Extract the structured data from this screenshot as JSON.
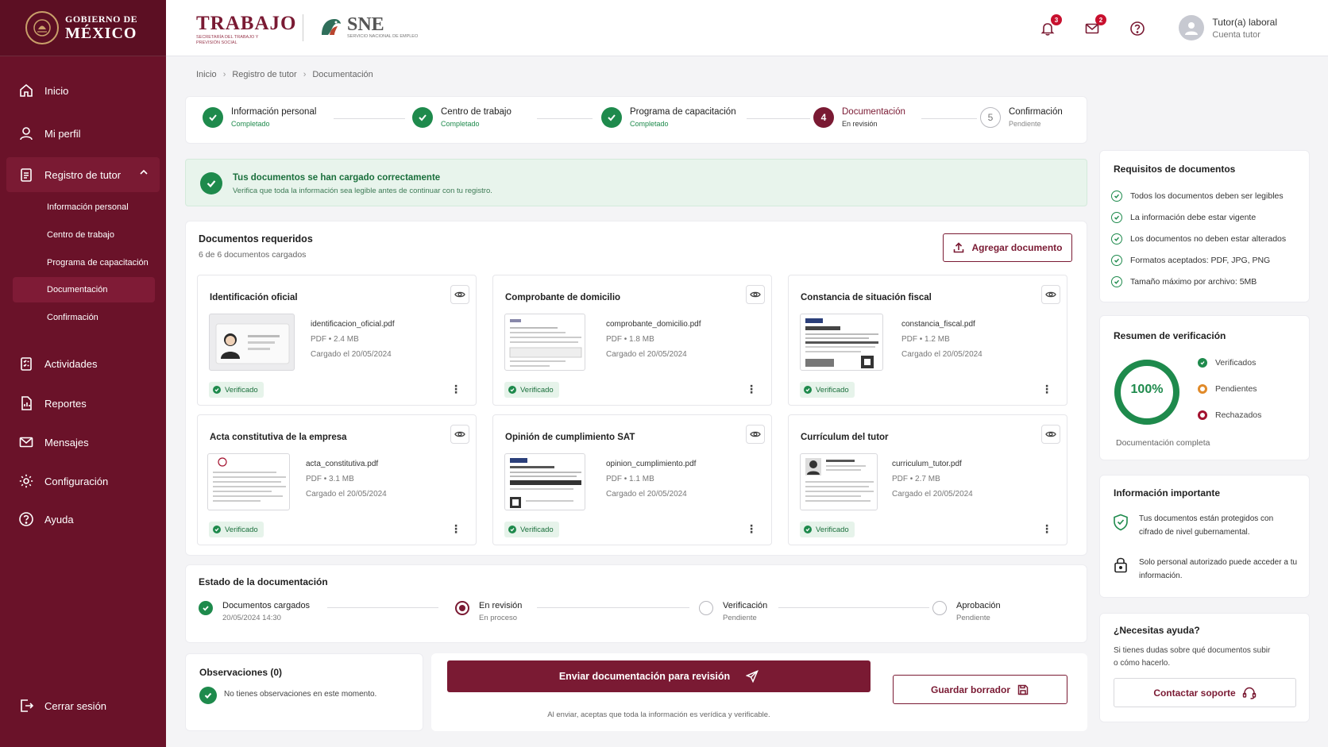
{
  "brand": {
    "line1": "GOBIERNO DE",
    "line2": "MÉXICO"
  },
  "header": {
    "trabajo_title": "TRABAJO",
    "trabajo_sub": "SECRETARÍA DEL TRABAJO Y PREVISIÓN SOCIAL",
    "sne_title": "SNE",
    "sne_sub": "SERVICIO NACIONAL DE EMPLEO",
    "notifications_count": "3",
    "messages_count": "2",
    "user_name": "Tutor(a) laboral",
    "user_role": "Cuenta tutor"
  },
  "sidebar": {
    "inicio": "Inicio",
    "perfil": "Mi perfil",
    "registro": "Registro de tutor",
    "sub": [
      "Información personal",
      "Centro de trabajo",
      "Programa de capacitación",
      "Documentación",
      "Confirmación"
    ],
    "actividades": "Actividades",
    "reportes": "Reportes",
    "mensajes": "Mensajes",
    "configuracion": "Configuración",
    "ayuda": "Ayuda",
    "logout": "Cerrar sesión"
  },
  "breadcrumb": [
    "Inicio",
    "Registro de tutor",
    "Documentación"
  ],
  "stepper": [
    {
      "label": "Información personal",
      "status": "Completado",
      "state": "done"
    },
    {
      "label": "Centro de trabajo",
      "status": "Completado",
      "state": "done"
    },
    {
      "label": "Programa de capacitación",
      "status": "Completado",
      "state": "done"
    },
    {
      "num": "4",
      "label": "Documentación",
      "status": "En revisión",
      "state": "current"
    },
    {
      "num": "5",
      "label": "Confirmación",
      "status": "Pendiente",
      "state": "pending"
    }
  ],
  "alert": {
    "title": "Tus documentos se han cargado correctamente",
    "text": "Verifica que toda la información sea legible antes de continuar con tu registro."
  },
  "documents": {
    "title": "Documentos requeridos",
    "subtitle": "6 de 6 documentos cargados",
    "add_label": "Agregar documento",
    "items": [
      {
        "title": "Identificación oficial",
        "file": "identificacion_oficial.pdf",
        "meta": "PDF • 2.4 MB",
        "date": "Cargado el 20/05/2024",
        "badge": "Verificado"
      },
      {
        "title": "Comprobante de domicilio",
        "file": "comprobante_domicilio.pdf",
        "meta": "PDF • 1.8 MB",
        "date": "Cargado el 20/05/2024",
        "badge": "Verificado"
      },
      {
        "title": "Constancia de situación fiscal",
        "file": "constancia_fiscal.pdf",
        "meta": "PDF • 1.2 MB",
        "date": "Cargado el 20/05/2024",
        "badge": "Verificado"
      },
      {
        "title": "Acta constitutiva de la empresa",
        "file": "acta_constitutiva.pdf",
        "meta": "PDF • 3.1 MB",
        "date": "Cargado el 20/05/2024",
        "badge": "Verificado"
      },
      {
        "title": "Opinión de cumplimiento SAT",
        "file": "opinion_cumplimiento.pdf",
        "meta": "PDF • 1.1 MB",
        "date": "Cargado el 20/05/2024",
        "badge": "Verificado"
      },
      {
        "title": "Currículum del tutor",
        "file": "curriculum_tutor.pdf",
        "meta": "PDF • 2.7 MB",
        "date": "Cargado el 20/05/2024",
        "badge": "Verificado"
      }
    ]
  },
  "status": {
    "title": "Estado de la documentación",
    "steps": [
      {
        "label": "Documentos cargados",
        "sub": "20/05/2024 14:30",
        "state": "done"
      },
      {
        "label": "En revisión",
        "sub": "En proceso",
        "state": "current"
      },
      {
        "label": "Verificación",
        "sub": "Pendiente",
        "state": "pending"
      },
      {
        "label": "Aprobación",
        "sub": "Pendiente",
        "state": "pending"
      }
    ]
  },
  "observations": {
    "title": "Observaciones (0)",
    "text": "No tienes observaciones en este momento."
  },
  "actions": {
    "submit": "Enviar documentación para revisión",
    "draft": "Guardar borrador",
    "disclaimer": "Al enviar, aceptas que toda la información es verídica y verificable."
  },
  "requirements": {
    "title": "Requisitos de documentos",
    "items": [
      "Todos los documentos deben ser legibles",
      "La información debe estar vigente",
      "Los documentos no deben estar alterados",
      "Formatos aceptados: PDF, JPG, PNG",
      "Tamaño máximo por archivo: 5MB"
    ]
  },
  "summary": {
    "title": "Resumen de verificación",
    "percent_label": "100%",
    "progress": 1.0,
    "legend": [
      "Verificados",
      "Pendientes",
      "Rechazados"
    ],
    "caption": "Documentación completa"
  },
  "important": {
    "title": "Información importante",
    "items": [
      "Tus documentos están protegidos con cifrado de nivel gubernamental.",
      "Solo personal autorizado puede acceder a tu información."
    ]
  },
  "help": {
    "title": "¿Necesitas ayuda?",
    "text": "Si tienes dudas sobre qué documentos subir o cómo hacerlo.",
    "button": "Contactar soporte"
  },
  "colors": {
    "primary": "#7a1a33",
    "sidebar": "#6a1229",
    "success": "#1e8a4c",
    "warning": "#e08a2a",
    "danger": "#a3122f"
  }
}
